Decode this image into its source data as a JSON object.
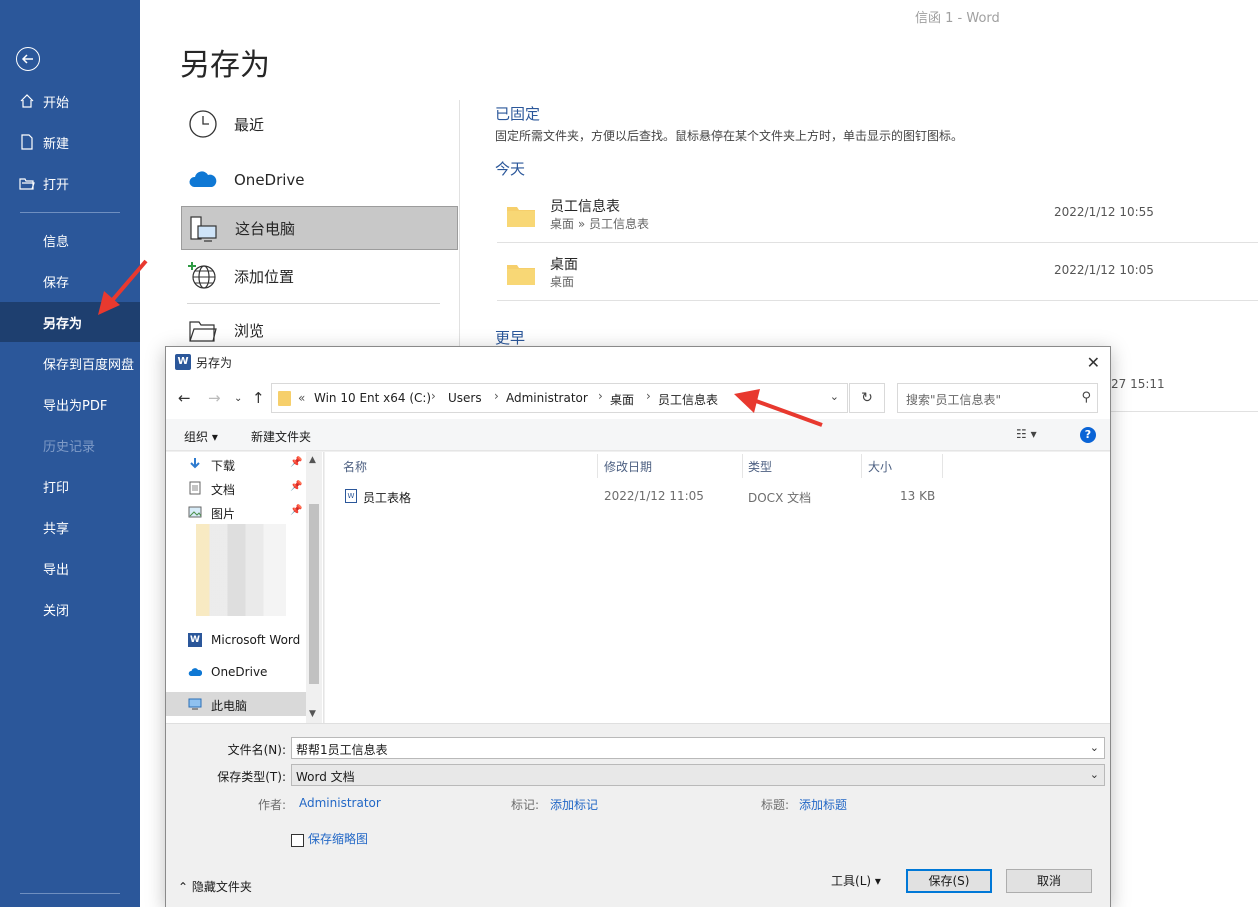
{
  "window_title": "信函 1 - Word",
  "nav": {
    "items": [
      {
        "label": "开始",
        "icon": "home-icon"
      },
      {
        "label": "新建",
        "icon": "new-document-icon"
      },
      {
        "label": "打开",
        "icon": "open-folder-icon"
      },
      {
        "label": "信息"
      },
      {
        "label": "保存"
      },
      {
        "label": "另存为",
        "active": true
      },
      {
        "label": "保存到百度网盘"
      },
      {
        "label": "导出为PDF"
      },
      {
        "label": "历史记录",
        "disabled": true
      },
      {
        "label": "打印"
      },
      {
        "label": "共享"
      },
      {
        "label": "导出"
      },
      {
        "label": "关闭"
      }
    ]
  },
  "page_title": "另存为",
  "locations": [
    {
      "label": "最近",
      "icon": "clock-icon"
    },
    {
      "label": "OneDrive",
      "icon": "cloud-icon"
    },
    {
      "label": "这台电脑",
      "icon": "computer-icon",
      "selected": true
    },
    {
      "label": "添加位置",
      "icon": "globe-add-icon"
    },
    {
      "label": "浏览",
      "icon": "open-folder-icon"
    }
  ],
  "pinned": {
    "heading": "已固定",
    "description": "固定所需文件夹，方便以后查找。鼠标悬停在某个文件夹上方时，单击显示的图钉图标。"
  },
  "today": {
    "heading": "今天",
    "items": [
      {
        "name": "员工信息表",
        "path": "桌面 » 员工信息表",
        "date": "2022/1/12 10:55"
      },
      {
        "name": "桌面",
        "path": "桌面",
        "date": "2022/1/12 10:05"
      }
    ]
  },
  "older": {
    "heading": "更早",
    "peek_date": "27 15:11"
  },
  "dialog": {
    "title": "另存为",
    "address": {
      "overflow": "«",
      "crumbs": [
        "Win 10 Ent x64 (C:)",
        "Users",
        "Administrator",
        "桌面",
        "员工信息表"
      ]
    },
    "search_placeholder": "搜索\"员工信息表\"",
    "commands": {
      "organize": "组织 ▾",
      "new_folder": "新建文件夹"
    },
    "tree": [
      {
        "label": "下载",
        "icon": "download-icon",
        "pinned": true
      },
      {
        "label": "文档",
        "icon": "document-icon",
        "pinned": true
      },
      {
        "label": "图片",
        "icon": "picture-icon",
        "pinned": true
      },
      {
        "label": "Microsoft Word",
        "icon": "word-icon"
      },
      {
        "label": "OneDrive",
        "icon": "cloud-icon"
      },
      {
        "label": "此电脑",
        "icon": "computer-icon",
        "selected": true
      }
    ],
    "columns": [
      "名称",
      "修改日期",
      "类型",
      "大小"
    ],
    "files": [
      {
        "name": "员工表格",
        "modified": "2022/1/12 11:05",
        "type": "DOCX 文档",
        "size": "13 KB"
      }
    ],
    "filename_label": "文件名(N):",
    "filename": "帮帮1员工信息表",
    "filetype_label": "保存类型(T):",
    "filetype": "Word 文档",
    "author_label": "作者:",
    "author": "Administrator",
    "tags_label": "标记:",
    "tags": "添加标记",
    "title_label": "标题:",
    "title_value": "添加标题",
    "thumbnail_label": "保存缩略图",
    "hide_folders": "隐藏文件夹",
    "tools": "工具(L)",
    "save": "保存(S)",
    "cancel": "取消"
  },
  "colors": {
    "nav_bg": "#2b579a",
    "nav_active": "#1e3f6f",
    "accent": "#2b579a",
    "arrow": "#e8392f"
  }
}
